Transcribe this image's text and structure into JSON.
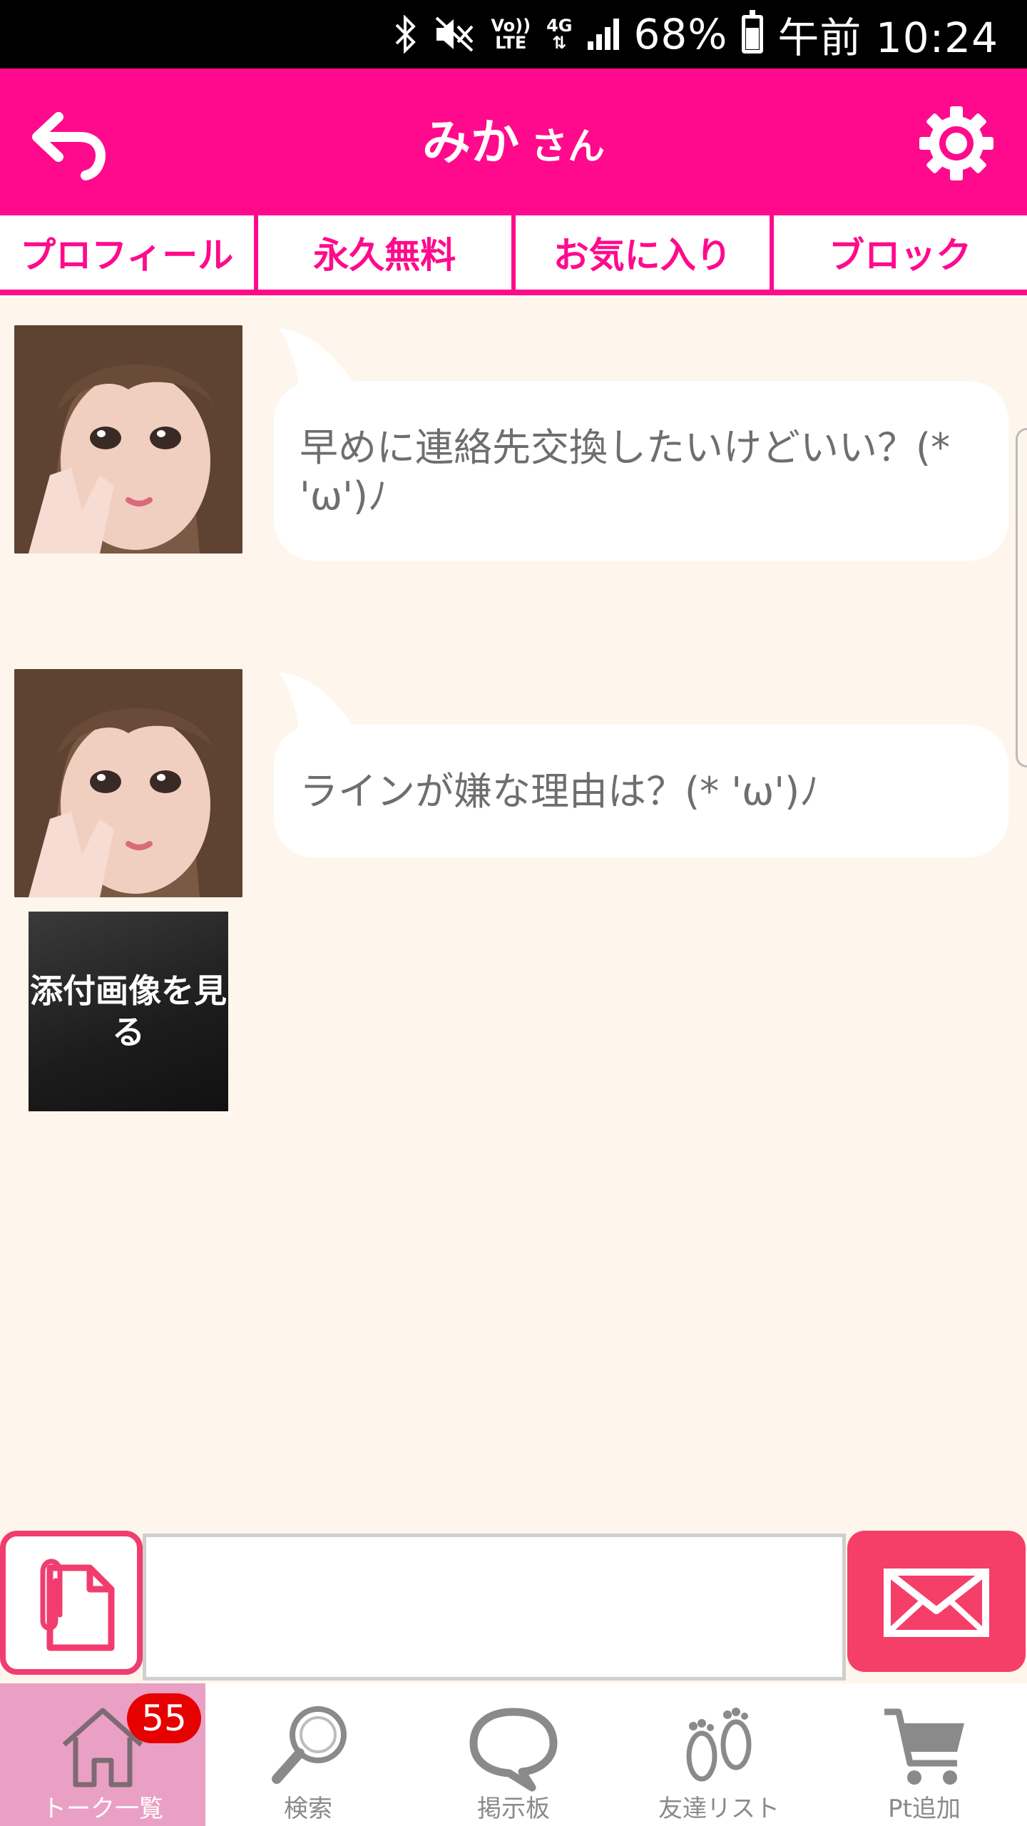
{
  "status_bar": {
    "battery_percent": "68%",
    "time": "午前 10:24",
    "network": "4G",
    "volte_label": "Vo)) LTE",
    "icons": [
      "bluetooth-icon",
      "mute-icon",
      "volte-icon",
      "4g-icon",
      "signal-icon",
      "battery-icon"
    ]
  },
  "header": {
    "name": "みか",
    "suffix": "さん",
    "back_icon": "back-arrow-icon",
    "settings_icon": "gear-icon",
    "bg_color": "#ff0a8c"
  },
  "tabs": [
    {
      "label": "プロフィール"
    },
    {
      "label": "永久無料"
    },
    {
      "label": "お気に入り"
    },
    {
      "label": "ブロック"
    }
  ],
  "messages": [
    {
      "text": "早めに連絡先交換したいけどいい？(* 'ω')ﾉ"
    },
    {
      "text": "ラインが嫌な理由は？(* 'ω')ﾉ"
    }
  ],
  "attachment": {
    "label": "添付画像を見る"
  },
  "composer": {
    "input_value": "",
    "attach_icon": "paperclip-file-icon",
    "send_icon": "envelope-icon",
    "accent_color": "#f53e68"
  },
  "bottom_nav": {
    "items": [
      {
        "label": "トーク一覧",
        "icon": "home-icon",
        "active": true,
        "badge": "55"
      },
      {
        "label": "検索",
        "icon": "search-icon"
      },
      {
        "label": "掲示板",
        "icon": "chat-bubble-icon"
      },
      {
        "label": "友達リスト",
        "icon": "footprints-icon"
      },
      {
        "label": "Pt追加",
        "icon": "cart-icon"
      }
    ]
  }
}
